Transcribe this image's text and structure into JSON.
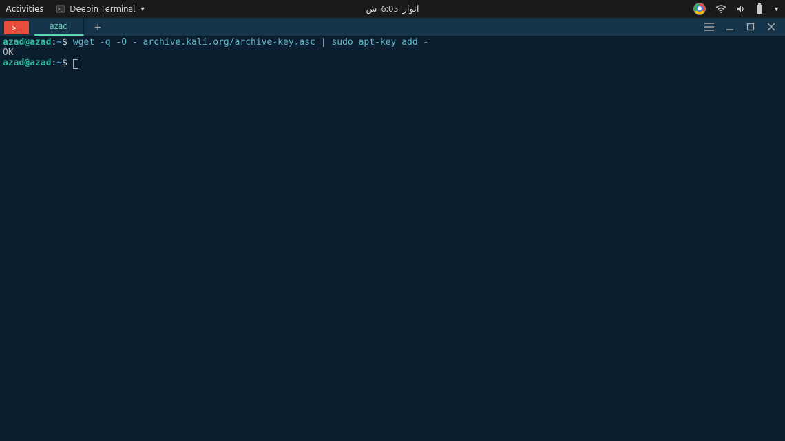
{
  "panel": {
    "activities": "Activities",
    "app_name": "Deepin Terminal",
    "clock_time": "6:03",
    "clock_text": "انوار",
    "clock_suffix": "ش"
  },
  "terminal": {
    "tab_label": "azad",
    "lines": [
      {
        "prompt_user": "azad@azad",
        "prompt_sep": ":",
        "prompt_path": "~",
        "prompt_end": "$ ",
        "command": "wget -q -O - archive.kali.org/archive-key.asc | sudo apt-key add -"
      }
    ],
    "output": "OK",
    "prompt2": {
      "user": "azad@azad",
      "sep": ":",
      "path": "~",
      "end": "$ "
    }
  }
}
